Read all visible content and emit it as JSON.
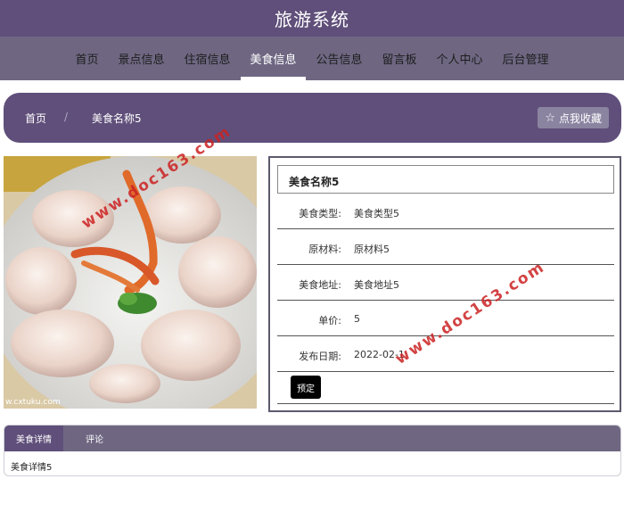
{
  "header": {
    "title": "旅游系统"
  },
  "nav": {
    "items": [
      {
        "label": "首页"
      },
      {
        "label": "景点信息"
      },
      {
        "label": "住宿信息"
      },
      {
        "label": "美食信息"
      },
      {
        "label": "公告信息"
      },
      {
        "label": "留言板"
      },
      {
        "label": "个人中心"
      },
      {
        "label": "后台管理"
      }
    ],
    "active": "美食信息"
  },
  "breadcrumb": {
    "home": "首页",
    "separator": "/",
    "current": "美食名称5",
    "favorite_label": "点我收藏",
    "favorite_icon": "star-outline-icon"
  },
  "detail": {
    "title": "美食名称5",
    "fields": [
      {
        "label": "美食类型:",
        "value": "美食类型5"
      },
      {
        "label": "原材料:",
        "value": "原材料5"
      },
      {
        "label": "美食地址:",
        "value": "美食地址5"
      },
      {
        "label": "单价:",
        "value": "5"
      },
      {
        "label": "发布日期:",
        "value": "2022-02-1"
      }
    ],
    "book_label": "预定"
  },
  "tabs": {
    "items": [
      {
        "label": "美食详情"
      },
      {
        "label": "评论"
      }
    ],
    "content": "美食详情5"
  },
  "image": {
    "watermark_text": "w.cxtuku.com"
  },
  "watermarks": [
    "www.doc163.com",
    "www.doc163.com"
  ],
  "colors": {
    "primary": "#5f4f7a",
    "nav": "#6f6782",
    "watermark": "#cc2222"
  }
}
